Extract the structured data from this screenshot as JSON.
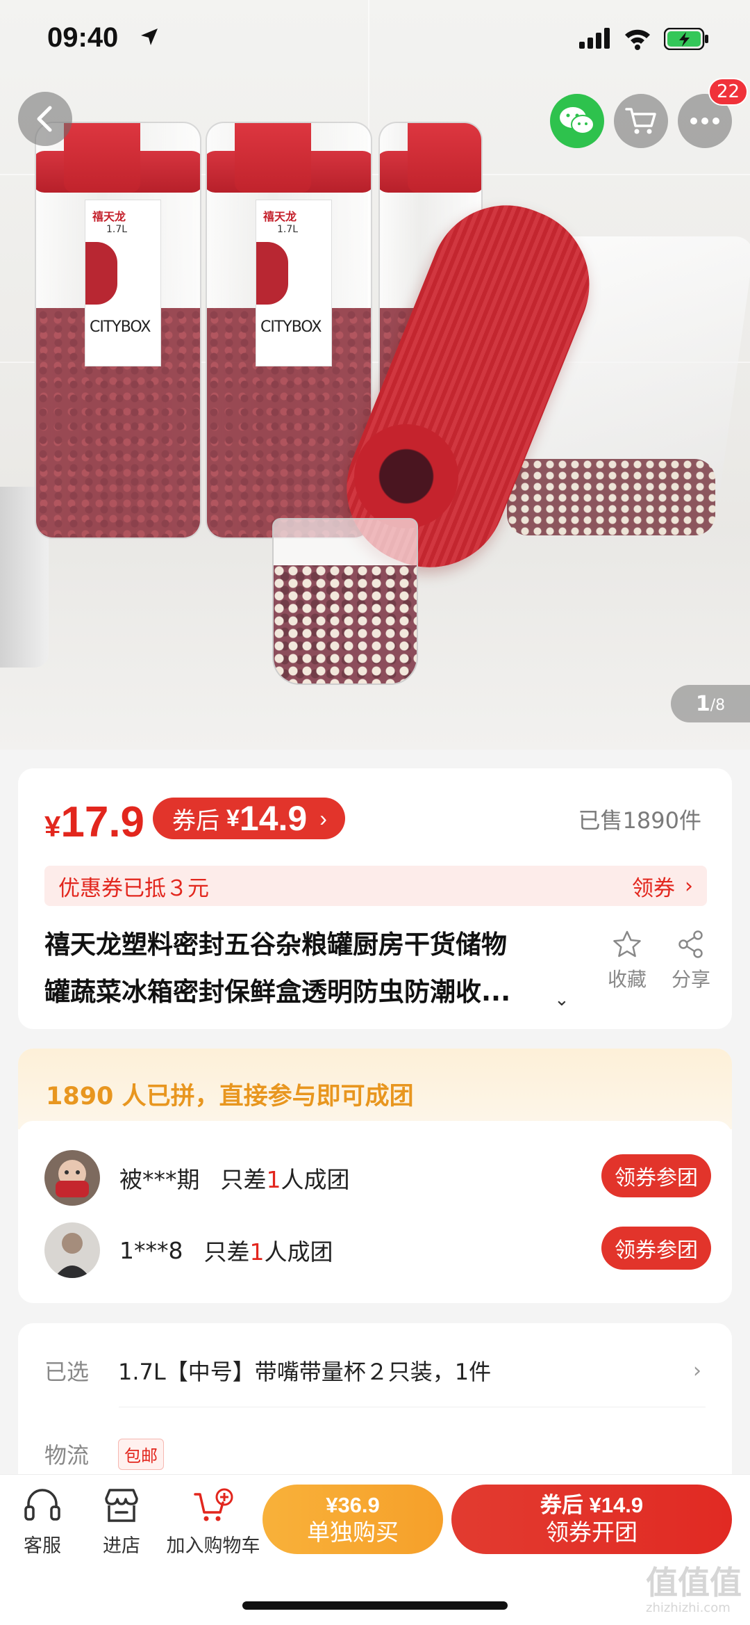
{
  "status_bar": {
    "time": "09:40"
  },
  "header": {
    "cart_badge": "22"
  },
  "gallery": {
    "jar_brand": "禧天龙",
    "jar_capacity": "1.7L",
    "jar_logo": "CITYBOX",
    "current": "1",
    "total": "/8"
  },
  "price": {
    "currency": "¥",
    "original": "17.9",
    "coupon_label": "券后",
    "coupon_price": "14.9",
    "sold": "已售1890件"
  },
  "coupon_strip": {
    "text": "优惠券已抵３元",
    "action": "领券"
  },
  "product": {
    "title_line1": "禧天龙塑料密封五谷杂粮罐厨房干货储物",
    "title_line2": "罐蔬菜冰箱密封保鲜盒透明防虫防潮收...",
    "favorite_label": "收藏",
    "share_label": "分享"
  },
  "group": {
    "header": "1890 人已拼，直接参与即可成团",
    "rows": [
      {
        "user": "被***期",
        "need_prefix": "只差",
        "need_count": "1",
        "need_suffix": "人成团",
        "button": "领券参团"
      },
      {
        "user": "1***8",
        "need_prefix": "只差",
        "need_count": "1",
        "need_suffix": "人成团",
        "button": "领券参团"
      }
    ]
  },
  "spec": {
    "selected_key": "已选",
    "selected_value": "1.7L【中号】带嘴带量杯２只装，1件",
    "logistics_key": "物流",
    "logistics_tag": "包邮"
  },
  "bottom_bar": {
    "service": "客服",
    "store": "进店",
    "add_cart": "加入购物车",
    "single_price": "¥36.9",
    "single_label": "单独购买",
    "group_price": "券后 ¥14.9",
    "group_label": "领券开团"
  },
  "watermark": {
    "text": "值值值",
    "sub": "zhizhizhi.com"
  },
  "colors": {
    "accent_red": "#e2261d",
    "wechat_green": "#2ec24d",
    "orange": "#f6a02a"
  }
}
